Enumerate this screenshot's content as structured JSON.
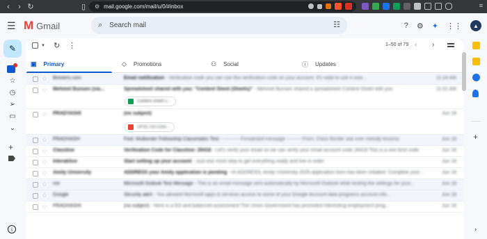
{
  "browser": {
    "url": "mail.google.com/mail/u/0/#inbox",
    "ext_badge": "0",
    "ext_badge2": "1"
  },
  "header": {
    "app_name": "Gmail",
    "search_placeholder": "Search mail"
  },
  "toolbar": {
    "page_info": "1–50 of 79"
  },
  "tabs": [
    {
      "label": "Primary",
      "icon": "inbox-icon"
    },
    {
      "label": "Promotions",
      "icon": "tag-icon"
    },
    {
      "label": "Social",
      "icon": "people-icon"
    },
    {
      "label": "Updates",
      "icon": "info-icon"
    }
  ],
  "emails": [
    {
      "sender": "Brewers.com",
      "subject": "Email notification",
      "preview": " - Verification code you can use this verification code on your account. It's valid to use it now...",
      "date": "11:24 AM",
      "read": true
    },
    {
      "sender": "Mehmet Bunsen (via...",
      "subject": "Spreadsheet shared with you: \"Content Sheet (Sheets)\"",
      "preview": " - Mehmet Bunsen shared a spreadsheet Content Sheet with you",
      "date": "11:01 AM",
      "read": false,
      "chip": "Content Sheet 1..."
    },
    {
      "sender": "PRADYASHI",
      "subject": "(no subject)",
      "preview": "",
      "date": "Jun 18",
      "read": false,
      "chip": "UPSC GS Cour..."
    },
    {
      "sender": "PRADHASH",
      "subject": "Fwd: Multiorder Fellowship Classmates Test",
      "preview": " - ---------- Forwarded message --------- From: Class Border ask over melody lessons",
      "date": "Jun 18",
      "read": true
    },
    {
      "sender": "Classtine",
      "subject": "Verification Code for Classtine: 26418",
      "preview": " - Let's verify your email so we can verify your email account code 26418 This is a one time code",
      "date": "Jun 18",
      "read": false
    },
    {
      "sender": "Interaktive",
      "subject": "Start setting up your account",
      "preview": " - Just one more step to get everything ready and live in order",
      "date": "Jun 18",
      "read": false
    },
    {
      "sender": "Amity University",
      "subject": "ADDRESS your Amity application is pending",
      "preview": " - Hi ADDRESS, Amity University 2025 application form has been initiated. Complete your...",
      "date": "Jun 18",
      "read": false
    },
    {
      "sender": "me",
      "subject": "Microsoft Outlook Test Message",
      "preview": " - This is an email message sent automatically by Microsoft Outlook while testing the settings for your...",
      "date": "Jun 18",
      "read": true
    },
    {
      "sender": "Google",
      "subject": "Security alert",
      "preview": " - You allowed Microsoft apps & services access to some of your Google Account data programs account info...",
      "date": "Jun 18",
      "read": true
    },
    {
      "sender": "PRADHASHI",
      "subject": "(no subject)",
      "preview": " - Here is a GS and balanced assessment The Union Government has promoted interesting employment prog...",
      "date": "Jun 18",
      "read": false
    }
  ],
  "colors": {
    "accent": "#0b57d0",
    "compose_bg": "#c2e7ff",
    "search_bg": "#e9eef6"
  }
}
